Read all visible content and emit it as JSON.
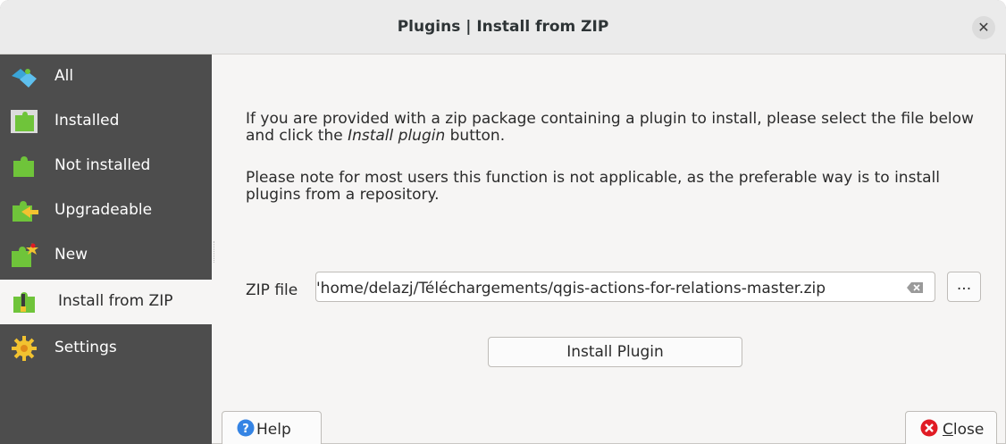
{
  "window": {
    "title": "Plugins | Install from ZIP",
    "close_glyph": "✕"
  },
  "sidebar": {
    "items": [
      {
        "label": "All",
        "icon": "puzzle-all-icon"
      },
      {
        "label": "Installed",
        "icon": "puzzle-installed-icon"
      },
      {
        "label": "Not installed",
        "icon": "puzzle-not-installed-icon"
      },
      {
        "label": "Upgradeable",
        "icon": "puzzle-upgradeable-icon"
      },
      {
        "label": "New",
        "icon": "puzzle-new-icon"
      },
      {
        "label": "Install from ZIP",
        "icon": "puzzle-zip-icon",
        "selected": true
      },
      {
        "label": "Settings",
        "icon": "gear-icon"
      }
    ]
  },
  "main": {
    "intro_prefix": "If you are provided with a zip package containing a plugin to install, please select the file below and click the ",
    "intro_emphasis": "Install plugin",
    "intro_suffix": " button.",
    "note": "Please note for most users this function is not applicable, as the preferable way is to install plugins from a repository.",
    "zip_label": "ZIP file",
    "zip_value": "'home/delazj/Téléchargements/qgis-actions-for-relations-master.zip",
    "browse_label": "...",
    "install_label": "Install Plugin"
  },
  "footer": {
    "help_label": "Help",
    "close_label_mnemonic": "C",
    "close_label_rest": "lose"
  },
  "colors": {
    "sidebar": "#4d4d4d",
    "selected": "#f6f5f4",
    "accent": "#3584e4",
    "danger": "#e01b24"
  }
}
